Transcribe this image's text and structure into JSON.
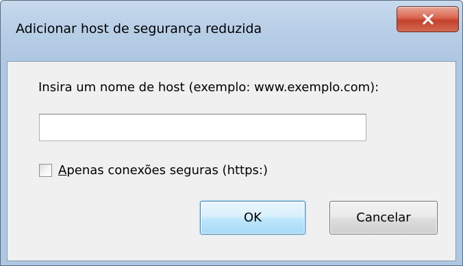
{
  "dialog": {
    "title": "Adicionar host de segurança reduzida",
    "close_icon": "close-x-icon",
    "prompt": "Insira um nome de host (exemplo: www.exemplo.com):",
    "host_input": {
      "value": "",
      "placeholder": ""
    },
    "secure_only": {
      "mnemonic": "A",
      "label_rest": "penas conexões seguras (https:)",
      "checked": false
    },
    "ok_label": "OK",
    "cancel_label": "Cancelar"
  },
  "colors": {
    "titlebar": "#b9cfe7",
    "client": "#f0f0f0",
    "close_button": "#c4422c",
    "ok_border": "#3c7fb1"
  }
}
